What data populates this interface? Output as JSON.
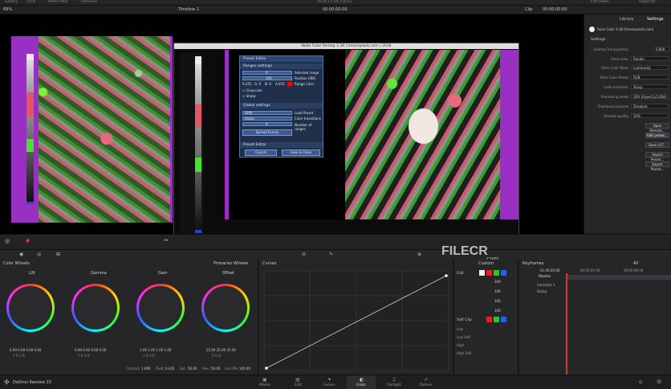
{
  "topbar": {
    "items": [
      "Gallery",
      "LUTs",
      "Media Pool",
      "Timelines",
      "",
      "2018-11-19_15h53",
      "",
      "",
      "Edit Index",
      "Inspector"
    ],
    "clip_label": "Clip"
  },
  "viewer": {
    "zoom": "69%",
    "timeline": "Timeline 1",
    "timecode": "00:00:00:00",
    "right_timecode": "00:00:00:00"
  },
  "false_color": {
    "window_title": "Nobe Color Remap 3.38 | timeinpixels.com | 2018",
    "preset_editor": {
      "title": "Preset Editor",
      "ranges_header": "Ranges settings",
      "selected_range_value": "0",
      "selected_range_label": "Selected range",
      "position_value": "100",
      "position_label": "Position (IRE)",
      "rgb_r": "R:255",
      "rgb_g": "G: 0",
      "rgb_b": "B: 0",
      "rgb_a": "A:255",
      "range_color_label": "Range Color",
      "grayscale_label": "Grayscale",
      "sharp_label": "Sharp",
      "global_header": "Global settings",
      "load_preset_value": "ARRI",
      "load_preset_label": "Load Preset",
      "transitions_value": "Sharp",
      "transitions_label": "Color transitions",
      "ranges_count": "9",
      "ranges_label": "Number of ranges",
      "spread_button": "Spread Evenly",
      "preset_editor_toggle": "Preset Editor",
      "cancel_button": "Cancel",
      "save_close_button": "Save & Close"
    }
  },
  "right_panel": {
    "tab_library": "Library",
    "tab_settings": "Settings",
    "plugin_name": "False Color 3.38 (timeinpixels.com)",
    "section": "Settings",
    "rows": [
      {
        "label": "Overlay Transparency",
        "value": "0.800"
      },
      {
        "label": "Show color",
        "value": "Render"
      },
      {
        "label": "False Color Mode",
        "value": "Luminosity"
      },
      {
        "label": "False Color Preset",
        "value": "RGB"
      },
      {
        "label": "Color transition",
        "value": "Sharp"
      },
      {
        "label": "Processing mode",
        "value": "GPU (OpenCL/CUDA)"
      },
      {
        "label": "Thumbnail preview",
        "value": "Disabled"
      },
      {
        "label": "Remote quality",
        "value": "50%"
      }
    ],
    "buttons": [
      "Open Remote...",
      "Edit preset...",
      "Save LUT...",
      "Import Preset...",
      "Export Preset..."
    ]
  },
  "color_wheels": {
    "title": "Color Wheels",
    "mode": "Primaries Wheels",
    "wheels": [
      {
        "name": "Lift",
        "values": "0.00  0.00  0.00  0.00",
        "channels": "Y  R  G  B"
      },
      {
        "name": "Gamma",
        "values": "0.00  0.00  0.00  0.00",
        "channels": "Y  R  G  B"
      },
      {
        "name": "Gain",
        "values": "1.00  1.00  1.00  1.00",
        "channels": "Y  R  G  B"
      },
      {
        "name": "Offset",
        "values": "25.00  25.00  25.00",
        "channels": "R  G  B"
      }
    ],
    "footer": {
      "contrast_label": "Contrast",
      "contrast": "1.000",
      "pivot_label": "Pivot",
      "pivot": "0.435",
      "sat_label": "Sat",
      "sat": "50.00",
      "hue_label": "Hue",
      "hue": "50.00",
      "lummix_label": "Lum Mix",
      "lummix": "100.00"
    }
  },
  "curves": {
    "title": "Curves"
  },
  "custom": {
    "title": "Custom",
    "edit_label": "Edit",
    "values": [
      "100",
      "100",
      "100",
      "100"
    ],
    "soft_clip_label": "Soft Clip",
    "soft_rows": [
      "Low",
      "Low Soft",
      "High",
      "High Soft"
    ]
  },
  "keyframes": {
    "title": "Keyframes",
    "filter": "All",
    "tc1": "01:00:00:00",
    "tc2": "00:00:00:00",
    "tc3": "00:00:08:00",
    "master": "Master",
    "tracks": [
      "Corrector 1",
      "Sizing"
    ]
  },
  "watermark": "FILECR",
  "watermark_sub": ".com",
  "bottombar": {
    "app": "DaVinci Resolve 15",
    "pages": [
      "Media",
      "Edit",
      "Fusion",
      "Color",
      "Fairlight",
      "Deliver"
    ],
    "active_page": "Color"
  },
  "colors": {
    "accent_purple": "#9a2fc3",
    "false_green": "#4fe62e",
    "false_pink": "#e46a7b",
    "active_page": "#d4d4d4"
  }
}
